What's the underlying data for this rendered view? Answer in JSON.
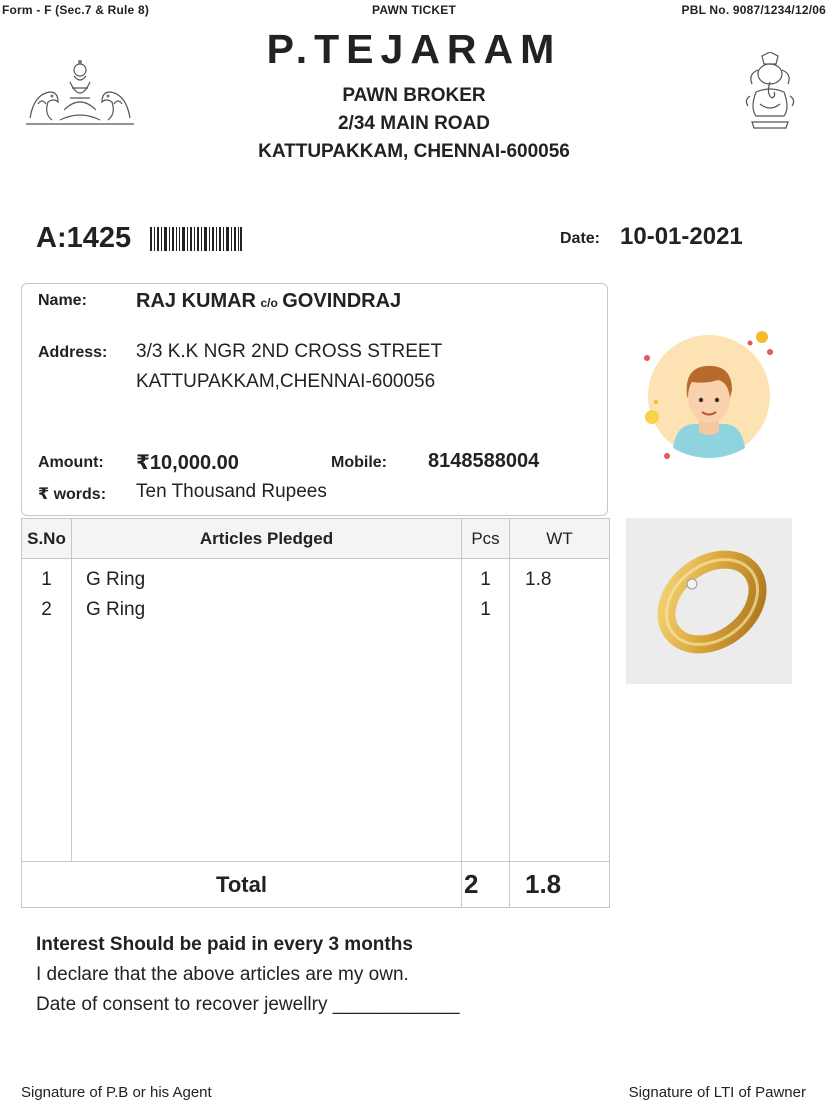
{
  "header": {
    "form_ref": "Form - F (Sec.7 & Rule 8)",
    "doc_type": "PAWN TICKET",
    "licence_no": "PBL No. 9087/1234/12/06",
    "business_name": "P.TEJARAM",
    "business_type": "PAWN BROKER",
    "address_line1": "2/34 MAIN ROAD",
    "address_line2": "KATTUPAKKAM, CHENNAI-600056",
    "left_emblem_icon": "lakshmi-deity-icon",
    "right_emblem_icon": "ganesha-deity-icon"
  },
  "ticket": {
    "account_no": "A:1425",
    "date_label": "Date:",
    "date_value": "10-01-2021"
  },
  "customer": {
    "name_label": "Name:",
    "name": "RAJ KUMAR",
    "co_label": "c/o",
    "guardian": "GOVINDRAJ",
    "address_label": "Address:",
    "address_line1": "3/3 K.K NGR 2ND CROSS STREET",
    "address_line2": "KATTUPAKKAM,CHENNAI-600056",
    "amount_label": "Amount:",
    "amount": "₹10,000.00",
    "mobile_label": "Mobile:",
    "mobile": "8148588004",
    "words_label": "₹ words:",
    "amount_words": "Ten Thousand Rupees",
    "photo_icon": "customer-avatar-icon"
  },
  "articles": {
    "headers": {
      "sno": "S.No",
      "article": "Articles Pledged",
      "pcs": "Pcs",
      "wt": "WT"
    },
    "rows": [
      {
        "sno": "1",
        "article": "G Ring",
        "pcs": "1",
        "wt": "1.8"
      },
      {
        "sno": "2",
        "article": "G Ring",
        "pcs": "1",
        "wt": ""
      }
    ],
    "total_label": "Total",
    "total_pcs": "2",
    "total_wt": "1.8",
    "item_photo_icon": "gold-ring-icon"
  },
  "notes": {
    "interest": "Interest Should be paid in every 3 months",
    "declaration": "I declare that the above articles are my own.",
    "consent": "Date of consent to recover jewellry ____________"
  },
  "signatures": {
    "left": "Signature of P.B or his Agent",
    "right": "Signature of LTI of Pawner"
  },
  "colors": {
    "text": "#222222",
    "border": "#c8c8c8",
    "header_fill": "#f4f4f4",
    "avatar_bg": "#fde3b4",
    "shirt": "#8fd3df",
    "gold": "#d9a53a"
  }
}
